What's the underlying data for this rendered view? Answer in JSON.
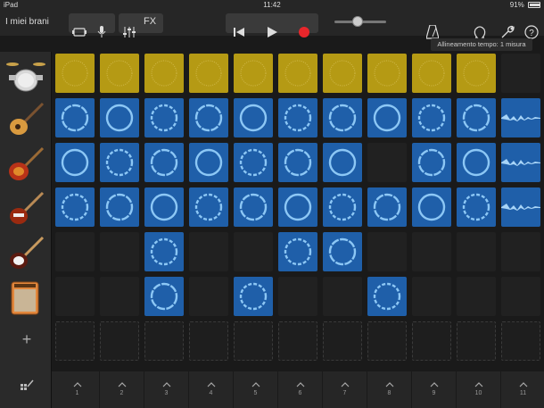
{
  "status": {
    "device": "iPad",
    "time": "11:42",
    "battery": "91%",
    "battery_level": 0.91
  },
  "toolbar": {
    "title": "I miei brani",
    "fx_label": "FX",
    "volume_level": 0.45
  },
  "tooltip": "Allineamento tempo: 1 misura",
  "tracks": [
    {
      "name": "drums",
      "icon": "drum-kit-icon"
    },
    {
      "name": "guitar1",
      "icon": "acoustic-guitar-icon"
    },
    {
      "name": "guitar2",
      "icon": "electric-guitar-sunburst-icon"
    },
    {
      "name": "guitar3",
      "icon": "electric-guitar-icon"
    },
    {
      "name": "guitar4",
      "icon": "electric-guitar-white-icon"
    },
    {
      "name": "amp",
      "icon": "amp-icon"
    }
  ],
  "grid": [
    [
      "Y",
      "Y",
      "Y",
      "Y",
      "Y",
      "Y",
      "Y",
      "Y",
      "Y",
      "Y",
      "E"
    ],
    [
      "B",
      "B",
      "B",
      "B",
      "B",
      "B",
      "B",
      "B",
      "B",
      "B",
      "W"
    ],
    [
      "B",
      "B",
      "B",
      "B",
      "B",
      "B",
      "B",
      "E",
      "B",
      "B",
      "W"
    ],
    [
      "B",
      "B",
      "B",
      "B",
      "B",
      "B",
      "B",
      "B",
      "B",
      "B",
      "W"
    ],
    [
      "E",
      "E",
      "B",
      "E",
      "E",
      "B",
      "B",
      "E",
      "E",
      "E",
      "E"
    ],
    [
      "E",
      "E",
      "B",
      "E",
      "B",
      "E",
      "E",
      "B",
      "E",
      "E",
      "E"
    ],
    [
      "D",
      "D",
      "D",
      "D",
      "D",
      "D",
      "D",
      "D",
      "D",
      "D",
      "D"
    ]
  ],
  "columns": [
    "1",
    "2",
    "3",
    "4",
    "5",
    "6",
    "7",
    "8",
    "9",
    "10",
    "11"
  ]
}
